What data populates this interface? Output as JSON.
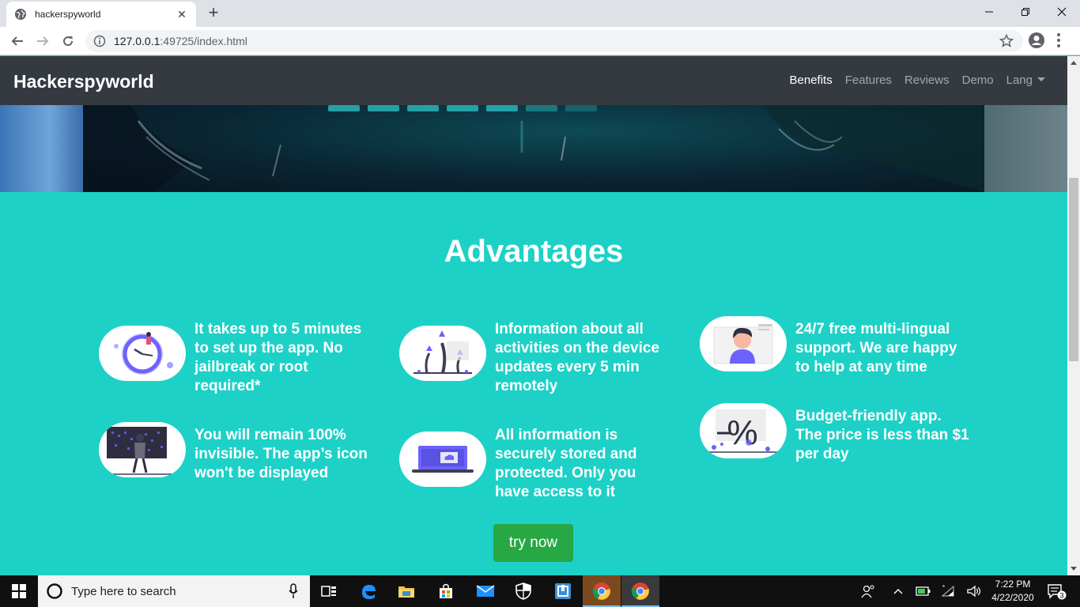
{
  "browser": {
    "tab_title": "hackerspyworld",
    "url_host": "127.0.0.1",
    "url_rest": ":49725/index.html"
  },
  "site": {
    "brand": "Hackerspyworld",
    "nav": [
      {
        "label": "Benefits",
        "active": true
      },
      {
        "label": "Features",
        "active": false
      },
      {
        "label": "Reviews",
        "active": false
      },
      {
        "label": "Demo",
        "active": false
      },
      {
        "label": "Lang",
        "active": false
      }
    ]
  },
  "advantages": {
    "title": "Advantages",
    "items": [
      {
        "text": "It takes up to 5 minutes to set up the app. No jailbreak or root required*",
        "icon": "clock-illustration-icon"
      },
      {
        "text": "Information about all activities on the device updates every 5 min remotely",
        "icon": "growth-arrows-illustration-icon"
      },
      {
        "text": "24/7 free multi-lingual support. We are happy to help at any time",
        "icon": "support-person-illustration-icon"
      },
      {
        "text": "You will remain 100% invisible. The app’s icon won't be displayed",
        "icon": "hacker-screen-illustration-icon"
      },
      {
        "text": "All information is securely stored and protected. Only you have access to it",
        "icon": "cloud-laptop-illustration-icon"
      },
      {
        "text": "Budget-friendly app. The price is less than $1 per day",
        "icon": "percent-discount-illustration-icon"
      }
    ],
    "cta": "try now"
  },
  "taskbar": {
    "search_placeholder": "Type here to search",
    "time": "7:22 PM",
    "date": "4/22/2020",
    "notification_count": "3"
  },
  "colors": {
    "page_bg": "#1dd1c7",
    "navbar": "#343a40",
    "cta": "#28a745",
    "illustration_accent": "#6c63ff"
  }
}
